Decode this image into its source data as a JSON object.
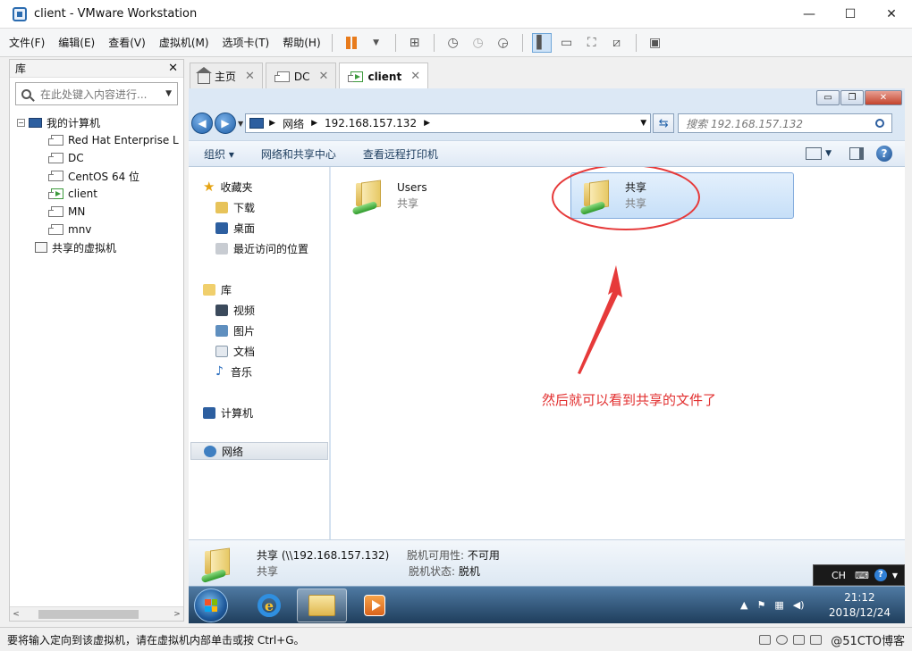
{
  "window": {
    "title": "client - VMware Workstation",
    "controls": [
      "—",
      "☐",
      "✕"
    ]
  },
  "menubar": {
    "items": [
      "文件(F)",
      "编辑(E)",
      "查看(V)",
      "虚拟机(M)",
      "选项卡(T)",
      "帮助(H)"
    ]
  },
  "library": {
    "title": "库",
    "close": "✕",
    "search_placeholder": "在此处键入内容进行...",
    "root": "我的计算机",
    "vms": [
      "Red Hat Enterprise L",
      "DC",
      "CentOS 64 位",
      "client",
      "MN",
      "mnv"
    ],
    "running_vm": "client",
    "shared": "共享的虚拟机"
  },
  "tabs": [
    {
      "label": "主页",
      "icon": "home-icon",
      "active": false
    },
    {
      "label": "DC",
      "icon": "vm-icon",
      "active": false
    },
    {
      "label": "client",
      "icon": "vm-icon",
      "active": true
    }
  ],
  "explorer": {
    "controls": [
      "▭",
      "❐",
      "✕"
    ],
    "breadcrumb": [
      "网络",
      "192.168.157.132"
    ],
    "search_placeholder": "搜索 192.168.157.132",
    "commands": [
      "组织 ▾",
      "网络和共享中心",
      "查看远程打印机"
    ],
    "nav": {
      "favorites": "收藏夹",
      "favorites_items": [
        "下载",
        "桌面",
        "最近访问的位置"
      ],
      "libraries": "库",
      "libraries_items": [
        "视频",
        "图片",
        "文档",
        "音乐"
      ],
      "computer": "计算机",
      "network": "网络"
    },
    "items": [
      {
        "name": "Users",
        "type": "共享"
      },
      {
        "name": "共享",
        "type": "共享"
      }
    ],
    "annotation": "然后就可以看到共享的文件了",
    "details": {
      "name": "共享 (\\\\192.168.157.132)",
      "type": "共享",
      "offline_avail_label": "脱机可用性:",
      "offline_avail_value": "不可用",
      "offline_status_label": "脱机状态:",
      "offline_status_value": "脱机"
    }
  },
  "langbar": {
    "lang": "CH"
  },
  "tray": {
    "time": "21:12",
    "date": "2018/12/24"
  },
  "statusbar": {
    "message": "要将输入定向到该虚拟机，请在虚拟机内部单击或按 Ctrl+G。",
    "watermark": "@51CTO博客"
  },
  "colors": {
    "annotation": "#e23030",
    "selection": "#c6dff8"
  }
}
